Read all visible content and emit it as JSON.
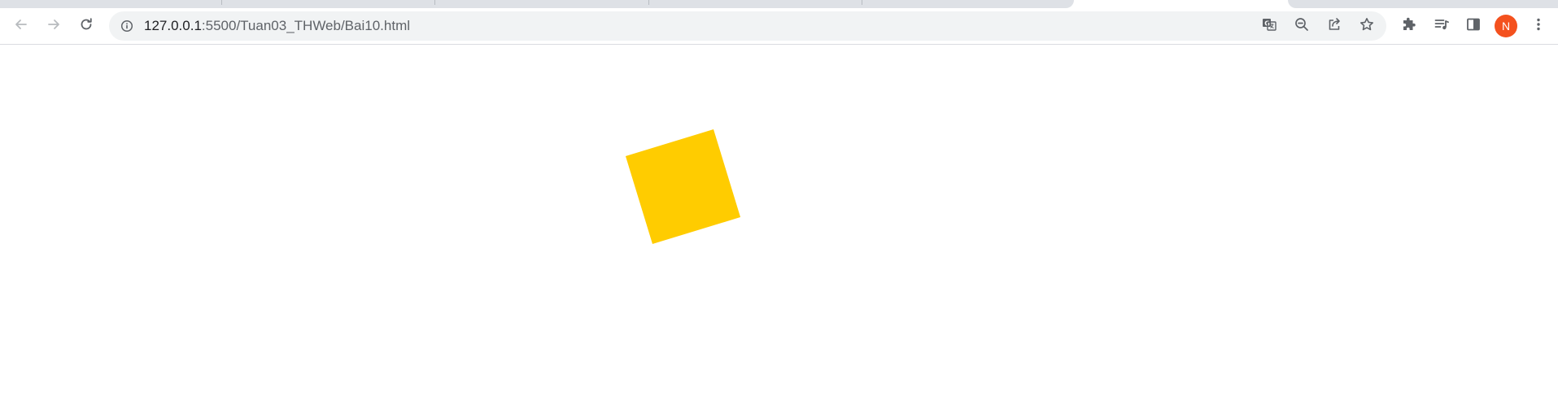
{
  "browser": {
    "url_host": "127.0.0.1",
    "url_path": ":5500/Tuan03_THWeb/Bai10.html",
    "profile_initial": "N",
    "profile_color": "#f4511e"
  },
  "toolbar_icons": {
    "back": "arrow-left-icon",
    "forward": "arrow-right-icon",
    "reload": "reload-icon",
    "site_info": "info-icon",
    "translate": "translate-icon",
    "zoom": "zoom-out-icon",
    "share": "share-icon",
    "bookmark": "star-icon",
    "extensions": "puzzle-icon",
    "media": "media-queue-icon",
    "side_panel": "side-panel-icon",
    "menu": "more-vertical-icon"
  },
  "page": {
    "shape_color": "#ffcc00",
    "shape_rotation_deg": -17
  }
}
